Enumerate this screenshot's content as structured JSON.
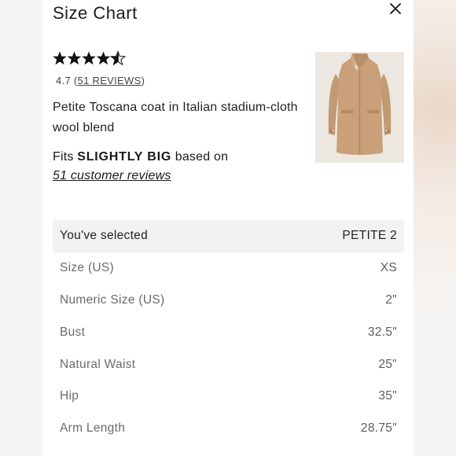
{
  "modal": {
    "title": "Size Chart"
  },
  "product": {
    "rating_value": "4.7",
    "rating_open": "(",
    "reviews_link": "51 REVIEWS",
    "rating_close": ")",
    "name": "Petite Toscana coat in Italian stadium-cloth wool blend",
    "fit_prefix": "Fits",
    "fit_value": "SLIGHTLY BIG",
    "fit_suffix": "based on",
    "fit_link": "51 customer reviews",
    "stars_filled": 4.5,
    "stars_total": 5
  },
  "size_table": {
    "rows": [
      {
        "label": "You've selected",
        "value": "PETITE 2"
      },
      {
        "label": "Size (US)",
        "value": "XS"
      },
      {
        "label": "Numeric Size (US)",
        "value": "2\""
      },
      {
        "label": "Bust",
        "value": "32.5\""
      },
      {
        "label": "Natural Waist",
        "value": "25\""
      },
      {
        "label": "Hip",
        "value": "35\""
      },
      {
        "label": "Arm Length",
        "value": "28.75\""
      }
    ]
  },
  "colors": {
    "panel_bg": "#ffffff",
    "selected_row_bg": "#f3f2f1",
    "coat": "#c9a07a"
  },
  "icons": {
    "close": "close-icon",
    "star": "star-icon"
  }
}
